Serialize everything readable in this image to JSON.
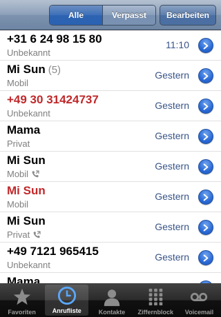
{
  "nav": {
    "segments": [
      {
        "label": "Alle",
        "active": true
      },
      {
        "label": "Verpasst",
        "active": false
      }
    ],
    "edit_label": "Bearbeiten"
  },
  "calls": [
    {
      "name": "+31 6 24 98 15 80",
      "count": "",
      "type": "Unbekannt",
      "time": "11:10",
      "missed": false,
      "outgoing": false
    },
    {
      "name": "Mi Sun",
      "count": "(5)",
      "type": "Mobil",
      "time": "Gestern",
      "missed": false,
      "outgoing": false
    },
    {
      "name": "+49 30 31424737",
      "count": "",
      "type": "Unbekannt",
      "time": "Gestern",
      "missed": true,
      "outgoing": false
    },
    {
      "name": "Mama",
      "count": "",
      "type": "Privat",
      "time": "Gestern",
      "missed": false,
      "outgoing": false
    },
    {
      "name": "Mi Sun",
      "count": "",
      "type": "Mobil",
      "time": "Gestern",
      "missed": false,
      "outgoing": true
    },
    {
      "name": "Mi Sun",
      "count": "",
      "type": "Mobil",
      "time": "Gestern",
      "missed": true,
      "outgoing": false
    },
    {
      "name": "Mi Sun",
      "count": "",
      "type": "Privat",
      "time": "Gestern",
      "missed": false,
      "outgoing": true
    },
    {
      "name": "+49 7121 965415",
      "count": "",
      "type": "Unbekannt",
      "time": "Gestern",
      "missed": false,
      "outgoing": false
    },
    {
      "name": "Mama",
      "count": "",
      "type": "",
      "time": "",
      "missed": false,
      "outgoing": false
    }
  ],
  "tabs": [
    {
      "label": "Favoriten",
      "icon": "star-icon",
      "selected": false
    },
    {
      "label": "Anrufliste",
      "icon": "clock-icon",
      "selected": true
    },
    {
      "label": "Kontakte",
      "icon": "contact-icon",
      "selected": false
    },
    {
      "label": "Ziffernblock",
      "icon": "keypad-icon",
      "selected": false
    },
    {
      "label": "Voicemail",
      "icon": "voicemail-icon",
      "selected": false
    }
  ],
  "colors": {
    "missed": "#c0282a",
    "time": "#385487",
    "accent": "#2a6ad6"
  }
}
